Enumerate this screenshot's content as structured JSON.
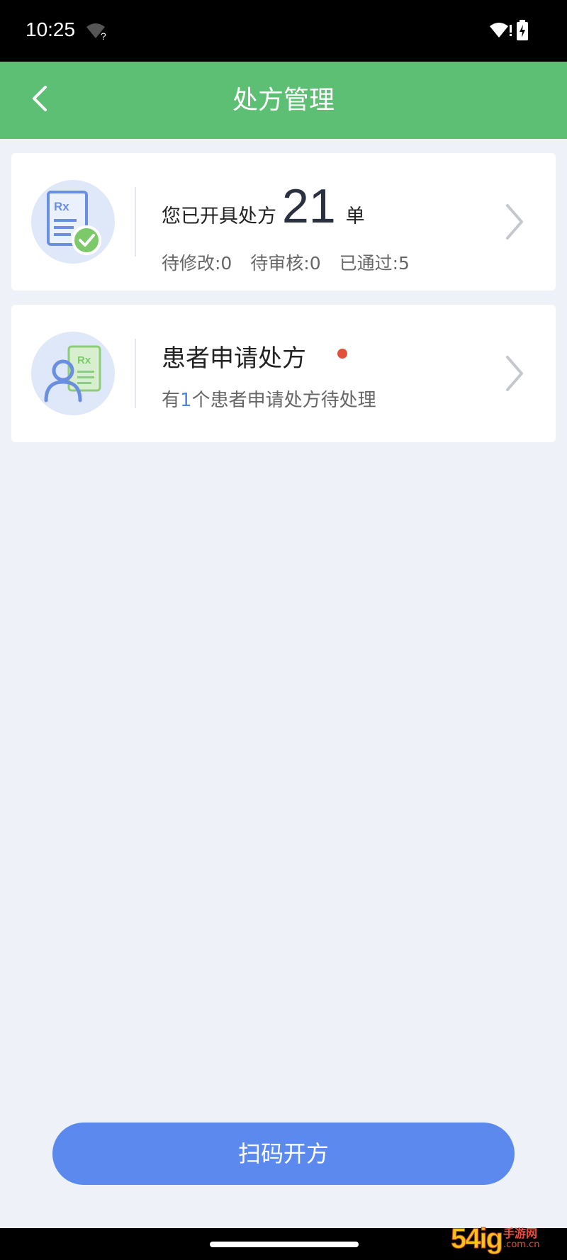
{
  "status_bar": {
    "time": "10:25",
    "icons": [
      "wifi-unknown-icon",
      "wifi-icon",
      "battery-charging-icon"
    ]
  },
  "header": {
    "title": "处方管理",
    "back_icon": "chevron-left-icon",
    "background": "#5dbf73"
  },
  "cards": {
    "issued": {
      "icon": "prescription-approved-icon",
      "prefix": "您已开具处方",
      "count": "21",
      "unit": "单",
      "stats": {
        "pending_modify": "待修改:0",
        "pending_review": "待审核:0",
        "approved": "已通过:5"
      }
    },
    "patient_requests": {
      "icon": "patient-prescription-icon",
      "title": "患者申请处方",
      "sub_before": "有",
      "sub_count": "1",
      "sub_after": "个患者申请处方待处理",
      "badge_color": "#e0533a"
    }
  },
  "actions": {
    "scan_label": "扫码开方",
    "scan_color": "#5b89ee"
  },
  "watermark": {
    "logo": "54ig",
    "name": "手游网",
    "url": ".com.cn"
  }
}
